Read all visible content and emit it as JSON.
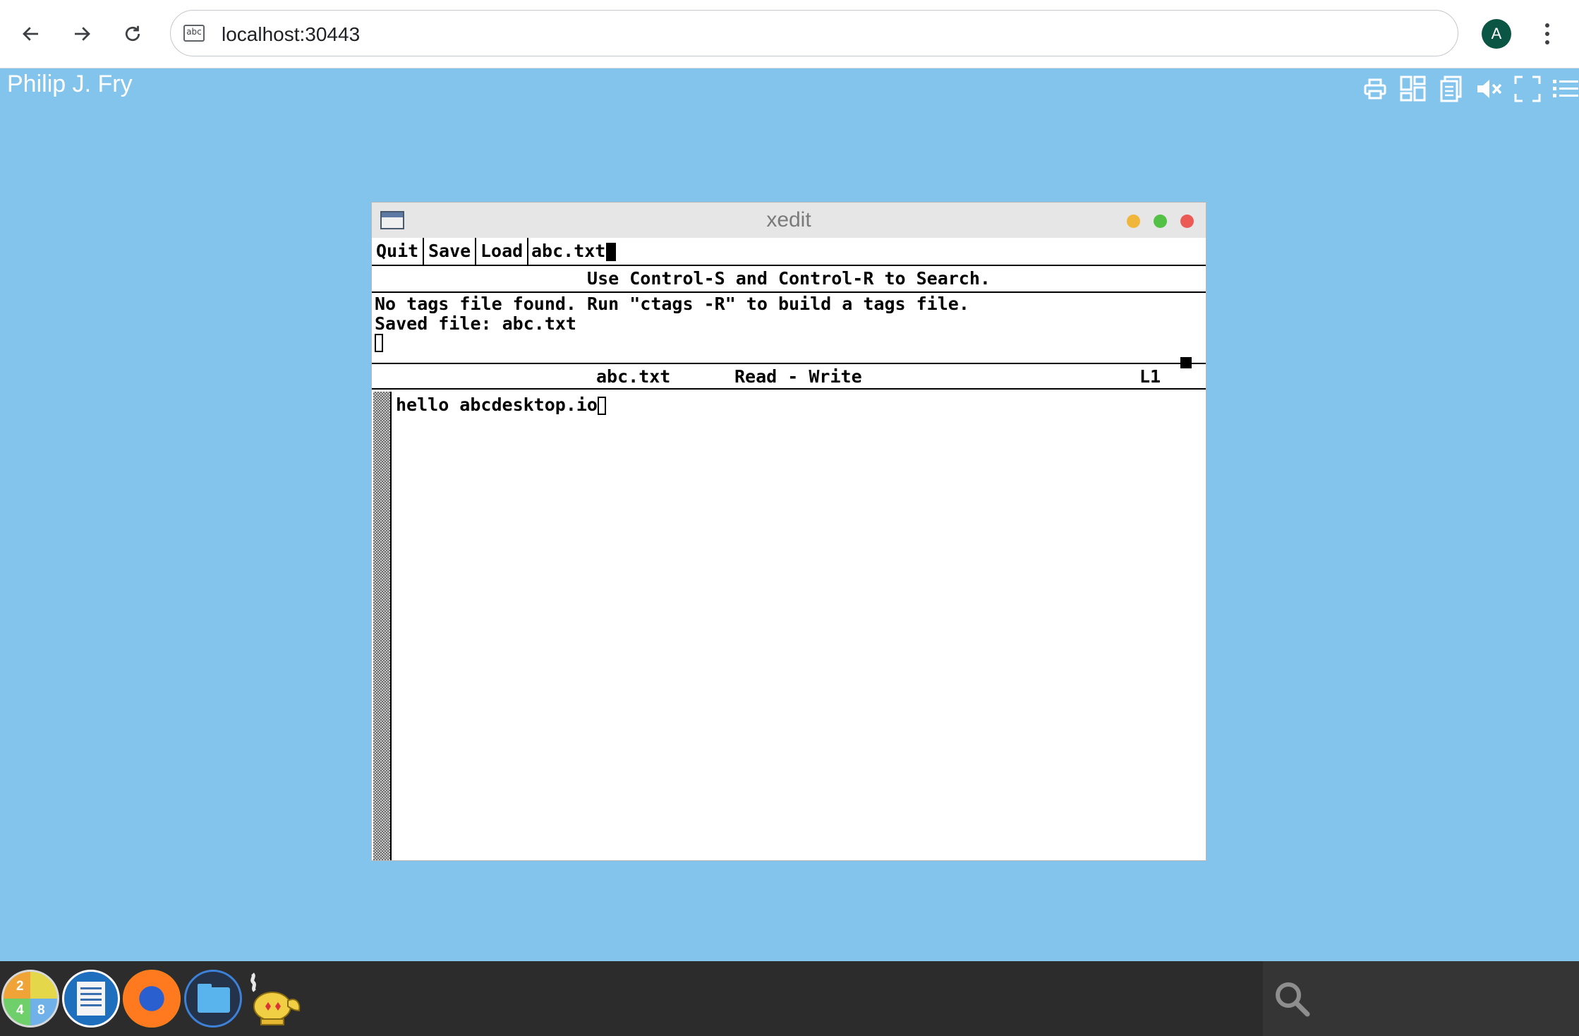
{
  "browser": {
    "url": "localhost:30443",
    "site_icon_text": "abc",
    "profile_initial": "A"
  },
  "desktop": {
    "user_name": "Philip J. Fry",
    "toolbar_icons": [
      "print-icon",
      "layout-grid-icon",
      "documents-icon",
      "mute-speaker-icon",
      "fullscreen-icon",
      "list-menu-icon"
    ]
  },
  "window": {
    "title": "xedit",
    "commands": [
      "Quit",
      "Save",
      "Load"
    ],
    "filename_input": "abc.txt",
    "hint": "Use Control-S and Control-R to Search.",
    "messages": [
      "No tags file found. Run \"ctags -R\" to build a tags file.",
      "Saved file: abc.txt"
    ],
    "status": {
      "filename": "abc.txt",
      "mode": "Read - Write",
      "line": "L1"
    },
    "content": "hello abcdesktop.io"
  },
  "dock": {
    "apps": [
      "calculator-icon",
      "text-editor-icon",
      "firefox-icon",
      "files-icon",
      "genie-lamp-icon"
    ],
    "calculator_digits": [
      "2",
      "4",
      "8"
    ]
  },
  "colors": {
    "desktop_bg": "#83c4ec",
    "taskbar_bg": "#2c2c2c",
    "close": "#ec5a55",
    "minimize": "#f0b63c",
    "maximize": "#53c046"
  }
}
